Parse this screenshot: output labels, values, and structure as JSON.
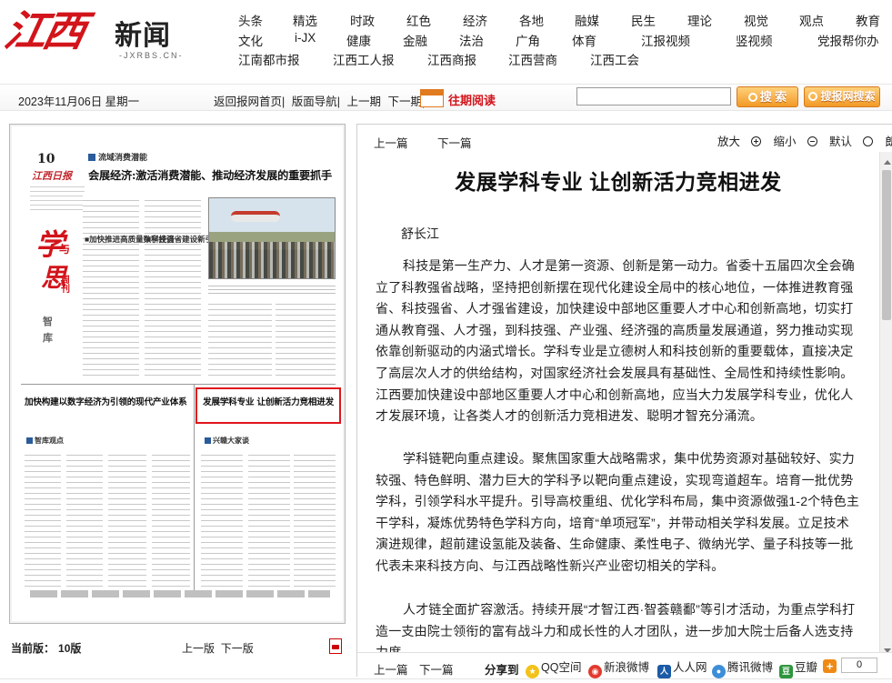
{
  "header": {
    "logo_mark": "江西",
    "logo_name": "新闻",
    "logo_domain": "-JXRBS.CN-",
    "nav_row1": [
      "头条",
      "精选",
      "时政",
      "红色",
      "经济",
      "各地",
      "融媒",
      "民生",
      "理论",
      "视觉",
      "观点",
      "教育"
    ],
    "nav_row2": [
      "文化",
      "i-JX",
      "健康",
      "金融",
      "法治",
      "广角",
      "体育",
      "江报视频",
      "竖视频",
      "党报帮你办"
    ],
    "nav_row3": [
      "江南都市报",
      "江西工人报",
      "江西商报",
      "江西营商",
      "江西工会"
    ]
  },
  "toolbar": {
    "date": "2023年11月06日 星期一",
    "links": [
      "返回报网首页|",
      "版面导航|",
      "上一期",
      "下一期|"
    ],
    "archive": "往期阅读",
    "search_value": "",
    "search_btn": "搜 索",
    "search_paper_btn": "搜报网搜索"
  },
  "paper": {
    "page_number": "10",
    "paper_logo": "江西日报",
    "section_label": "流域消费潜能",
    "headline": "会展经济:激活消费潜能、推动经济发展的重要抓手",
    "column_char1": "学",
    "column_char2": "与",
    "column_char3": "思",
    "column_week": "周刊",
    "column_sub": "智库",
    "subhead_a": "■加快推进高质量数字经济",
    "subhead_b": "■科技强省建设新引擎",
    "story_left": "加快构建以数字经济为引领的现代产业体系",
    "story_right": "发展学科专业 让创新活力竞相进发",
    "tag_left": "智库观点",
    "tag_right": "兴赣大家谈"
  },
  "left_footer": {
    "current_label": "当前版：",
    "current_value": "10版",
    "prev": "上一版",
    "next": "下一版"
  },
  "article": {
    "top_prev": "上一篇",
    "top_next": "下一篇",
    "zoom_in": "放大",
    "zoom_out": "缩小",
    "default": "默认",
    "read": "朗读",
    "title": "发展学科专业  让创新活力竞相进发",
    "author": "舒长江",
    "paragraphs": [
      "科技是第一生产力、人才是第一资源、创新是第一动力。省委十五届四次全会确立了科教强省战略，坚持把创新摆在现代化建设全局中的核心地位，一体推进教育强省、科技强省、人才强省建设，加快建设中部地区重要人才中心和创新高地，切实打通从教育强、人才强，到科技强、产业强、经济强的高质量发展通道，努力推动实现依靠创新驱动的内涵式增长。学科专业是立德树人和科技创新的重要载体，直接决定了高层次人才的供给结构，对国家经济社会发展具有基础性、全局性和持续性影响。江西要加快建设中部地区重要人才中心和创新高地，应当大力发展学科专业，优化人才发展环境，让各类人才的创新活力竞相进发、聪明才智充分涌流。",
      "学科链靶向重点建设。聚焦国家重大战略需求，集中优势资源对基础较好、实力较强、特色鲜明、潜力巨大的学科予以靶向重点建设，实现弯道超车。培育一批优势学科，引领学科水平提升。引导高校重组、优化学科布局，集中资源做强1-2个特色主干学科，凝炼优势特色学科方向，培育“单项冠军”，并带动相关学科发展。立足技术演进规律，超前建设氢能及装备、生命健康、柔性电子、微纳光学、量子科技等一批代表未来科技方向、与江西战略性新兴产业密切相关的学科。",
      "人才链全面扩容激活。持续开展“才智江西·智荟赣鄱”等引才活动，为重点学科打造一支由院士领衔的富有战斗力和成长性的人才团队，进一步加大院士后备人选支持力度。"
    ],
    "bottom_prev": "上一篇",
    "bottom_next": "下一篇",
    "share_label": "分享到",
    "share_qq": "QQ空间",
    "share_weibo": "新浪微博",
    "share_renren": "人人网",
    "share_tencent": "腾讯微博",
    "share_douban": "豆瓣",
    "share_count": "0"
  }
}
